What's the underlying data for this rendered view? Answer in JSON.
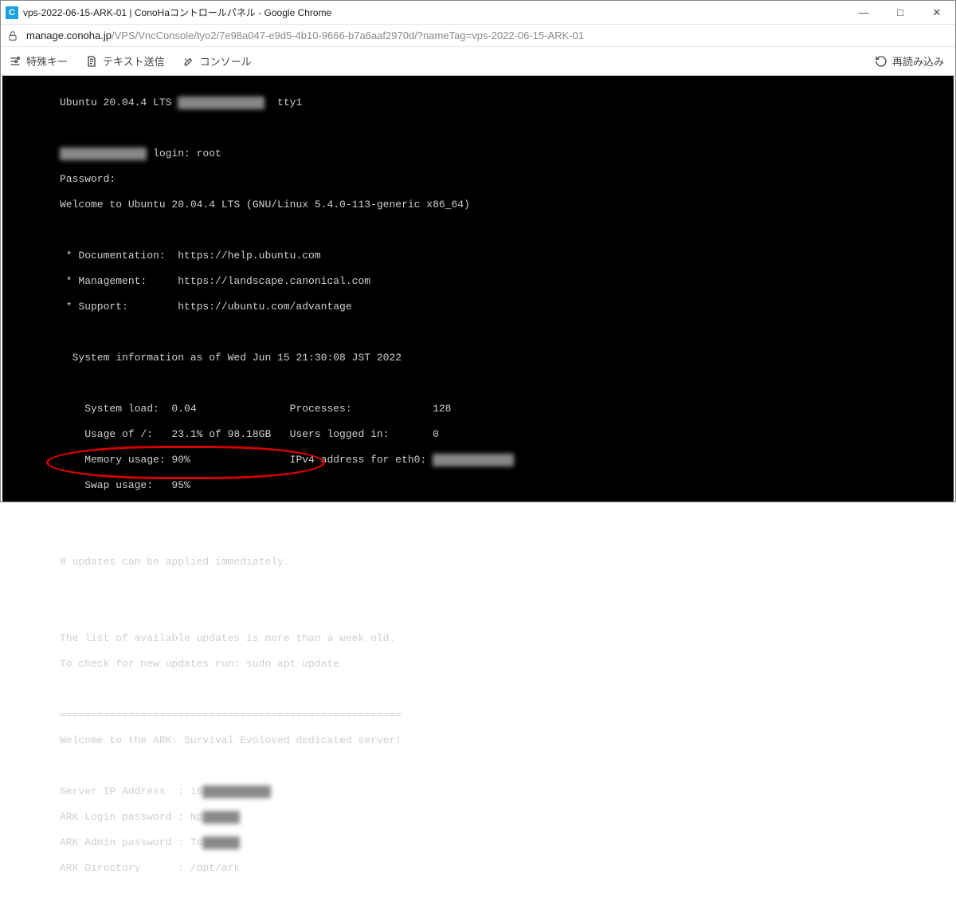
{
  "window": {
    "favicon_letter": "C",
    "title": "vps-2022-06-15-ARK-01 | ConoHaコントロールパネル - Google Chrome",
    "controls": {
      "minimize": "—",
      "maximize": "□",
      "close": "✕"
    }
  },
  "addressbar": {
    "host": "manage.conoha.jp",
    "path": "/VPS/VncConsole/tyo2/7e98a047-e9d5-4b10-9666-b7a6aaf2970d/?nameTag=vps-2022-06-15-ARK-01"
  },
  "toolbar": {
    "special_keys": "特殊キー",
    "send_text": "テキスト送信",
    "console": "コンソール",
    "reload": "再読み込み"
  },
  "console": {
    "banner_os": "Ubuntu 20.04.4 LTS ",
    "banner_tty": "  tty1",
    "login_prompt": " login: root",
    "password_label": "Password:",
    "welcome": "Welcome to Ubuntu 20.04.4 LTS (GNU/Linux 5.4.0-113-generic x86_64)",
    "doc_line": " * Documentation:  https://help.ubuntu.com",
    "mgmt_line": " * Management:     https://landscape.canonical.com",
    "support_line": " * Support:        https://ubuntu.com/advantage",
    "sysinfo_header": "  System information as of Wed Jun 15 21:30:08 JST 2022",
    "sysload": "    System load:  0.04               Processes:             128",
    "diskusage": "    Usage of /:   23.1% of 98.18GB   Users logged in:       0",
    "memusage": "    Memory usage: 90%                IPv4 address for eth0: ",
    "swapusage": "    Swap usage:   95%",
    "updates": "0 updates can be applied immediately.",
    "stale1": "The list of available updates is more than a week old.",
    "stale2": "To check for new updates run: sudo apt update",
    "divider": "=======================================================",
    "ark_welcome": "Welcome to the ARK: Survival Evoloved dedicated server!",
    "ark_ip": "Server IP Address  : 16",
    "ark_loginpw": "ARK Login password : Np",
    "ark_adminpw": "ARK Admin password : Tc",
    "ark_dir": "ARK Directory      : /opt/ark"
  }
}
